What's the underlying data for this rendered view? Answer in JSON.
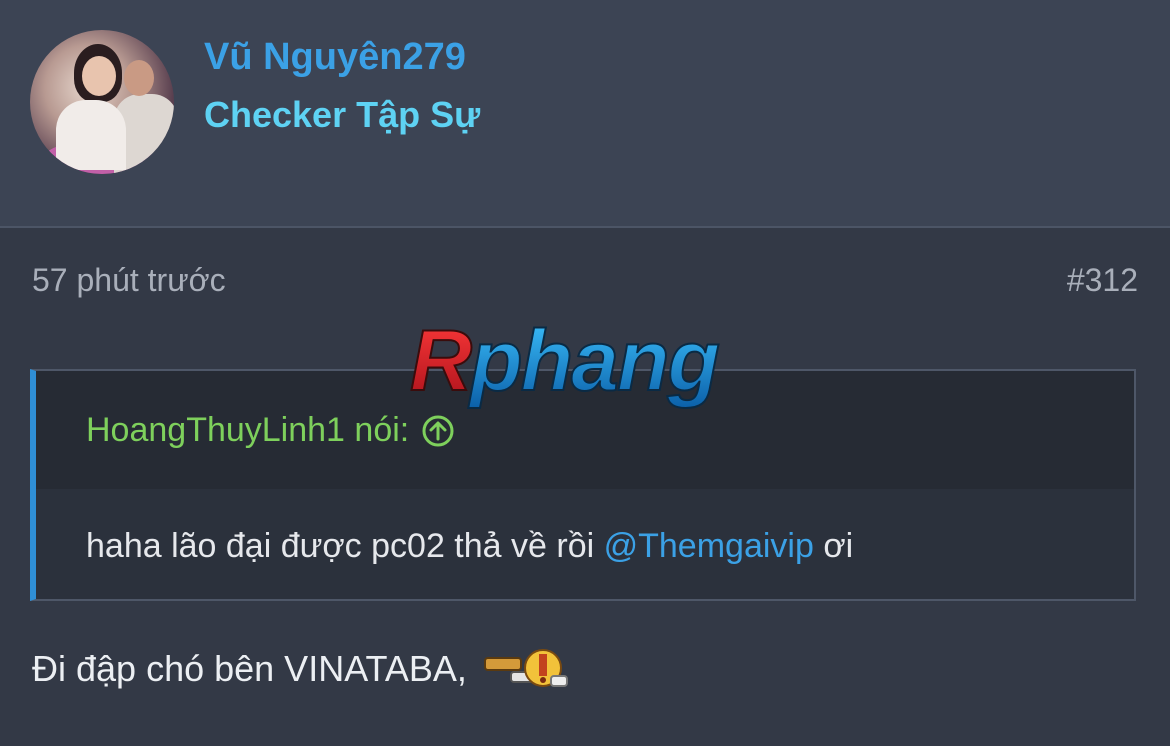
{
  "user": {
    "name": "Vũ Nguyên279",
    "title": "Checker Tập Sự",
    "avatar": "user-avatar-photo"
  },
  "meta": {
    "time": "57 phút trước",
    "post_number": "#312"
  },
  "watermark": {
    "text": "Rphang"
  },
  "quote": {
    "author_label": "HoangThuyLinh1 nói:",
    "author_icon": "arrow-up-circle-icon",
    "body_prefix": "haha lão đại được pc02 thả về rồi ",
    "mention": "@Themgaivip",
    "body_suffix": " ơi"
  },
  "post": {
    "text": "Đi đập chó bên VINATABA,",
    "emoticon": "smiley-emoticon-icon"
  },
  "colors": {
    "username": "#3ba1e6",
    "usertitle": "#5ed2f3",
    "quote_author": "#7ed05c",
    "quote_border": "#2f8fd6",
    "mention": "#3ba1e6"
  }
}
